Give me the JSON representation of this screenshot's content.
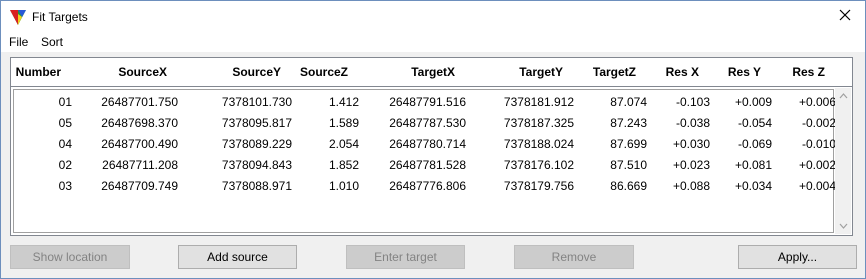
{
  "window": {
    "title": "Fit Targets"
  },
  "menu": {
    "file": "File",
    "sort": "Sort"
  },
  "columns": [
    "Number",
    "SourceX",
    "SourceY",
    "SourceZ",
    "TargetX",
    "TargetY",
    "TargetZ",
    "Res X",
    "Res Y",
    "Res Z"
  ],
  "rows": [
    [
      "01",
      "26487701.750",
      "7378101.730",
      "1.412",
      "26487791.516",
      "7378181.912",
      "87.074",
      "-0.103",
      "+0.009",
      "+0.006"
    ],
    [
      "05",
      "26487698.370",
      "7378095.817",
      "1.589",
      "26487787.530",
      "7378187.325",
      "87.243",
      "-0.038",
      "-0.054",
      "-0.002"
    ],
    [
      "04",
      "26487700.490",
      "7378089.229",
      "2.054",
      "26487780.714",
      "7378188.024",
      "87.699",
      "+0.030",
      "-0.069",
      "-0.010"
    ],
    [
      "02",
      "26487711.208",
      "7378094.843",
      "1.852",
      "26487781.528",
      "7378176.102",
      "87.510",
      "+0.023",
      "+0.081",
      "+0.002"
    ],
    [
      "03",
      "26487709.749",
      "7378088.971",
      "1.010",
      "26487776.806",
      "7378179.756",
      "86.669",
      "+0.088",
      "+0.034",
      "+0.004"
    ]
  ],
  "buttons": {
    "show_location": "Show location",
    "add_source": "Add source",
    "enter_target": "Enter target",
    "remove": "Remove",
    "apply": "Apply..."
  },
  "icons": {
    "app": "app-triangle-icon",
    "close": "close-icon"
  }
}
